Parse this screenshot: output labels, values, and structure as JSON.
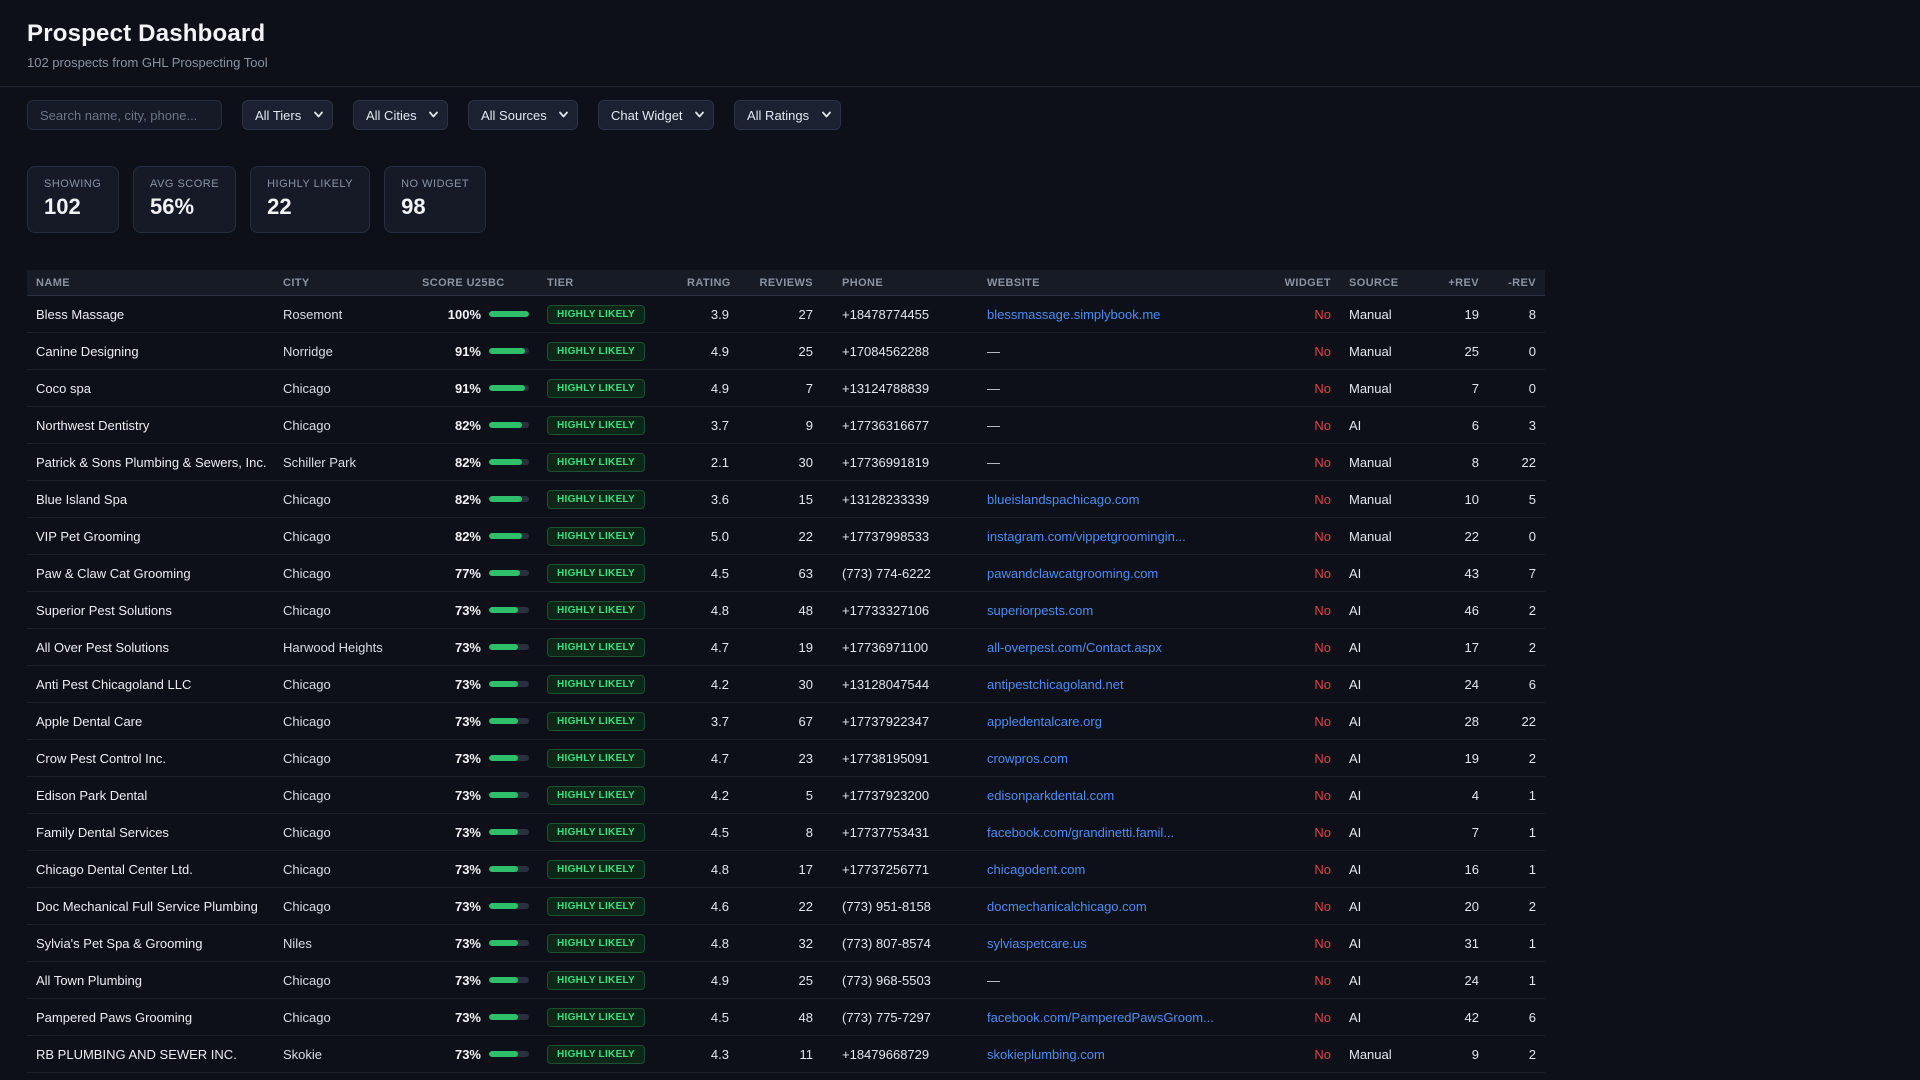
{
  "header": {
    "title": "Prospect Dashboard",
    "subtitle": "102 prospects from GHL Prospecting Tool"
  },
  "filters": {
    "search_placeholder": "Search name, city, phone...",
    "dropdowns": [
      {
        "label": "All Tiers"
      },
      {
        "label": "All Cities"
      },
      {
        "label": "All Sources"
      },
      {
        "label": "Chat Widget"
      },
      {
        "label": "All Ratings"
      }
    ]
  },
  "stats": [
    {
      "label": "SHOWING",
      "value": "102"
    },
    {
      "label": "AVG SCORE",
      "value": "56%"
    },
    {
      "label": "HIGHLY LIKELY",
      "value": "22"
    },
    {
      "label": "NO WIDGET",
      "value": "98"
    }
  ],
  "table": {
    "columns": [
      "NAME",
      "CITY",
      "SCORE U25BC",
      "TIER",
      "RATING",
      "REVIEWS",
      "PHONE",
      "WEBSITE",
      "WIDGET",
      "SOURCE",
      "+REV",
      "-REV"
    ],
    "rows": [
      {
        "name": "Bless Massage",
        "city": "Rosemont",
        "score_label": "100%",
        "score_pct": 100,
        "tier": "HIGHLY LIKELY",
        "rating": "3.9",
        "reviews": "27",
        "phone": "+18478774455",
        "website": "blessmassage.simplybook.me",
        "website_is_link": true,
        "widget": "No",
        "source": "Manual",
        "pos_rev": "19",
        "neg_rev": "8"
      },
      {
        "name": "Canine Designing",
        "city": "Norridge",
        "score_label": "91%",
        "score_pct": 91,
        "tier": "HIGHLY LIKELY",
        "rating": "4.9",
        "reviews": "25",
        "phone": "+17084562288",
        "website": "—",
        "website_is_link": false,
        "widget": "No",
        "source": "Manual",
        "pos_rev": "25",
        "neg_rev": "0"
      },
      {
        "name": "Coco spa",
        "city": "Chicago",
        "score_label": "91%",
        "score_pct": 91,
        "tier": "HIGHLY LIKELY",
        "rating": "4.9",
        "reviews": "7",
        "phone": "+13124788839",
        "website": "—",
        "website_is_link": false,
        "widget": "No",
        "source": "Manual",
        "pos_rev": "7",
        "neg_rev": "0"
      },
      {
        "name": "Northwest Dentistry",
        "city": "Chicago",
        "score_label": "82%",
        "score_pct": 82,
        "tier": "HIGHLY LIKELY",
        "rating": "3.7",
        "reviews": "9",
        "phone": "+17736316677",
        "website": "—",
        "website_is_link": false,
        "widget": "No",
        "source": "AI",
        "pos_rev": "6",
        "neg_rev": "3"
      },
      {
        "name": "Patrick & Sons Plumbing & Sewers, Inc.",
        "city": "Schiller Park",
        "score_label": "82%",
        "score_pct": 82,
        "tier": "HIGHLY LIKELY",
        "rating": "2.1",
        "reviews": "30",
        "phone": "+17736991819",
        "website": "—",
        "website_is_link": false,
        "widget": "No",
        "source": "Manual",
        "pos_rev": "8",
        "neg_rev": "22"
      },
      {
        "name": "Blue Island Spa",
        "city": "Chicago",
        "score_label": "82%",
        "score_pct": 82,
        "tier": "HIGHLY LIKELY",
        "rating": "3.6",
        "reviews": "15",
        "phone": "+13128233339",
        "website": "blueislandspachicago.com",
        "website_is_link": true,
        "widget": "No",
        "source": "Manual",
        "pos_rev": "10",
        "neg_rev": "5"
      },
      {
        "name": "VIP Pet Grooming",
        "city": "Chicago",
        "score_label": "82%",
        "score_pct": 82,
        "tier": "HIGHLY LIKELY",
        "rating": "5.0",
        "reviews": "22",
        "phone": "+17737998533",
        "website": "instagram.com/vippetgroomingin...",
        "website_is_link": true,
        "widget": "No",
        "source": "Manual",
        "pos_rev": "22",
        "neg_rev": "0"
      },
      {
        "name": "Paw & Claw Cat Grooming",
        "city": "Chicago",
        "score_label": "77%",
        "score_pct": 77,
        "tier": "HIGHLY LIKELY",
        "rating": "4.5",
        "reviews": "63",
        "phone": "(773) 774-6222",
        "website": "pawandclawcatgrooming.com",
        "website_is_link": true,
        "widget": "No",
        "source": "AI",
        "pos_rev": "43",
        "neg_rev": "7"
      },
      {
        "name": "Superior Pest Solutions",
        "city": "Chicago",
        "score_label": "73%",
        "score_pct": 73,
        "tier": "HIGHLY LIKELY",
        "rating": "4.8",
        "reviews": "48",
        "phone": "+17733327106",
        "website": "superiorpests.com",
        "website_is_link": true,
        "widget": "No",
        "source": "AI",
        "pos_rev": "46",
        "neg_rev": "2"
      },
      {
        "name": "All Over Pest Solutions",
        "city": "Harwood Heights",
        "score_label": "73%",
        "score_pct": 73,
        "tier": "HIGHLY LIKELY",
        "rating": "4.7",
        "reviews": "19",
        "phone": "+17736971100",
        "website": "all-overpest.com/Contact.aspx",
        "website_is_link": true,
        "widget": "No",
        "source": "AI",
        "pos_rev": "17",
        "neg_rev": "2"
      },
      {
        "name": "Anti Pest Chicagoland LLC",
        "city": "Chicago",
        "score_label": "73%",
        "score_pct": 73,
        "tier": "HIGHLY LIKELY",
        "rating": "4.2",
        "reviews": "30",
        "phone": "+13128047544",
        "website": "antipestchicagoland.net",
        "website_is_link": true,
        "widget": "No",
        "source": "AI",
        "pos_rev": "24",
        "neg_rev": "6"
      },
      {
        "name": "Apple Dental Care",
        "city": "Chicago",
        "score_label": "73%",
        "score_pct": 73,
        "tier": "HIGHLY LIKELY",
        "rating": "3.7",
        "reviews": "67",
        "phone": "+17737922347",
        "website": "appledentalcare.org",
        "website_is_link": true,
        "widget": "No",
        "source": "AI",
        "pos_rev": "28",
        "neg_rev": "22"
      },
      {
        "name": "Crow Pest Control Inc.",
        "city": "Chicago",
        "score_label": "73%",
        "score_pct": 73,
        "tier": "HIGHLY LIKELY",
        "rating": "4.7",
        "reviews": "23",
        "phone": "+17738195091",
        "website": "crowpros.com",
        "website_is_link": true,
        "widget": "No",
        "source": "AI",
        "pos_rev": "19",
        "neg_rev": "2"
      },
      {
        "name": "Edison Park Dental",
        "city": "Chicago",
        "score_label": "73%",
        "score_pct": 73,
        "tier": "HIGHLY LIKELY",
        "rating": "4.2",
        "reviews": "5",
        "phone": "+17737923200",
        "website": "edisonparkdental.com",
        "website_is_link": true,
        "widget": "No",
        "source": "AI",
        "pos_rev": "4",
        "neg_rev": "1"
      },
      {
        "name": "Family Dental Services",
        "city": "Chicago",
        "score_label": "73%",
        "score_pct": 73,
        "tier": "HIGHLY LIKELY",
        "rating": "4.5",
        "reviews": "8",
        "phone": "+17737753431",
        "website": "facebook.com/grandinetti.famil...",
        "website_is_link": true,
        "widget": "No",
        "source": "AI",
        "pos_rev": "7",
        "neg_rev": "1"
      },
      {
        "name": "Chicago Dental Center Ltd.",
        "city": "Chicago",
        "score_label": "73%",
        "score_pct": 73,
        "tier": "HIGHLY LIKELY",
        "rating": "4.8",
        "reviews": "17",
        "phone": "+17737256771",
        "website": "chicagodent.com",
        "website_is_link": true,
        "widget": "No",
        "source": "AI",
        "pos_rev": "16",
        "neg_rev": "1"
      },
      {
        "name": "Doc Mechanical Full Service Plumbing",
        "city": "Chicago",
        "score_label": "73%",
        "score_pct": 73,
        "tier": "HIGHLY LIKELY",
        "rating": "4.6",
        "reviews": "22",
        "phone": "(773) 951-8158",
        "website": "docmechanicalchicago.com",
        "website_is_link": true,
        "widget": "No",
        "source": "AI",
        "pos_rev": "20",
        "neg_rev": "2"
      },
      {
        "name": "Sylvia's Pet Spa & Grooming",
        "city": "Niles",
        "score_label": "73%",
        "score_pct": 73,
        "tier": "HIGHLY LIKELY",
        "rating": "4.8",
        "reviews": "32",
        "phone": "(773) 807-8574",
        "website": "sylviaspetcare.us",
        "website_is_link": true,
        "widget": "No",
        "source": "AI",
        "pos_rev": "31",
        "neg_rev": "1"
      },
      {
        "name": "All Town Plumbing",
        "city": "Chicago",
        "score_label": "73%",
        "score_pct": 73,
        "tier": "HIGHLY LIKELY",
        "rating": "4.9",
        "reviews": "25",
        "phone": "(773) 968-5503",
        "website": "—",
        "website_is_link": false,
        "widget": "No",
        "source": "AI",
        "pos_rev": "24",
        "neg_rev": "1"
      },
      {
        "name": "Pampered Paws Grooming",
        "city": "Chicago",
        "score_label": "73%",
        "score_pct": 73,
        "tier": "HIGHLY LIKELY",
        "rating": "4.5",
        "reviews": "48",
        "phone": "(773) 775-7297",
        "website": "facebook.com/PamperedPawsGroom...",
        "website_is_link": true,
        "widget": "No",
        "source": "AI",
        "pos_rev": "42",
        "neg_rev": "6"
      },
      {
        "name": "RB PLUMBING AND SEWER INC.",
        "city": "Skokie",
        "score_label": "73%",
        "score_pct": 73,
        "tier": "HIGHLY LIKELY",
        "rating": "4.3",
        "reviews": "11",
        "phone": "+18479668729",
        "website": "skokieplumbing.com",
        "website_is_link": true,
        "widget": "No",
        "source": "Manual",
        "pos_rev": "9",
        "neg_rev": "2"
      }
    ]
  },
  "colors": {
    "accent_green": "#2fbe6a",
    "badge_green": "#3ddf7f",
    "link_blue": "#4c8df5",
    "widget_no_red": "#e14444",
    "background": "#0d1018"
  }
}
